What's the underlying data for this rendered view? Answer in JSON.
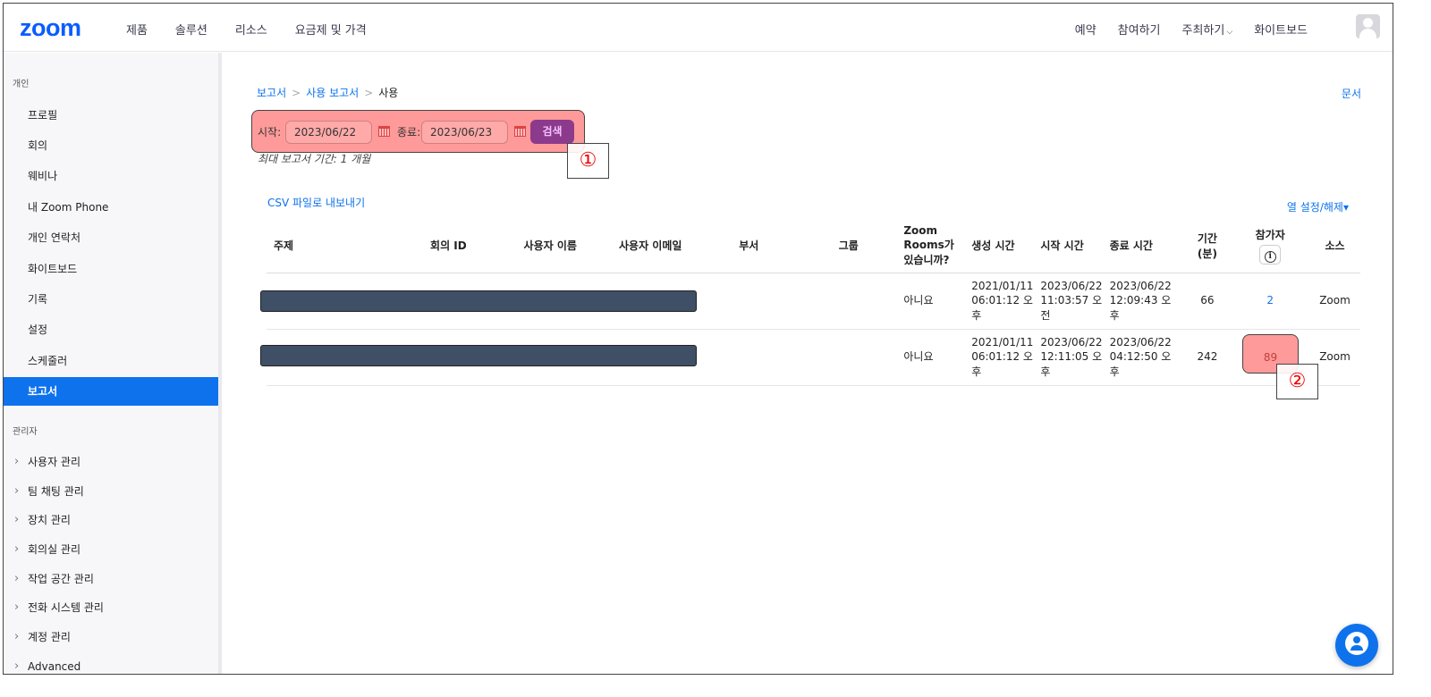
{
  "header": {
    "logo": "zoom",
    "nav_left": [
      "제품",
      "솔루션",
      "리소스",
      "요금제 및 가격"
    ],
    "nav_right": {
      "schedule": "예약",
      "join": "참여하기",
      "host": "주최하기",
      "whiteboard": "화이트보드"
    }
  },
  "sidebar": {
    "personal_label": "개인",
    "personal_items": [
      "프로필",
      "회의",
      "웨비나",
      "내 Zoom Phone",
      "개인 연락처",
      "화이트보드",
      "기록",
      "설정",
      "스케줄러",
      "보고서"
    ],
    "active_item": "보고서",
    "admin_label": "관리자",
    "admin_items": [
      "사용자 관리",
      "팀 채팅 관리",
      "장치 관리",
      "회의실 관리",
      "작업 공간 관리",
      "전화 시스템 관리",
      "계정 관리",
      "Advanced"
    ]
  },
  "breadcrumb": {
    "root": "보고서",
    "mid": "사용 보고서",
    "current": "사용"
  },
  "doc_link": "문서",
  "search": {
    "start_label": "시작:",
    "start_value": "2023/06/22",
    "end_label": "종료:",
    "end_value": "2023/06/23",
    "button": "검색",
    "note": "최대 보고서 기간: 1 개월"
  },
  "markers": {
    "one": "①",
    "two": "②"
  },
  "export_csv": "CSV 파일로 내보내기",
  "column_settings": "열 설정/해제▾",
  "table": {
    "headers": {
      "topic": "주제",
      "meeting_id": "회의 ID",
      "user_name": "사용자 이름",
      "user_email": "사용자 이메일",
      "department": "부서",
      "group": "그룹",
      "zoom_rooms": "Zoom Rooms가 있습니까?",
      "created": "생성 시간",
      "start": "시작 시간",
      "end": "종료 시간",
      "duration": "기간 (분)",
      "participants": "참가자",
      "source": "소스"
    },
    "rows": [
      {
        "zoom_rooms": "아니요",
        "created": "2021/01/11 06:01:12 오후",
        "start": "2023/06/22 11:03:57 오전",
        "end": "2023/06/22 12:09:43 오후",
        "duration": "66",
        "participants": "2",
        "source": "Zoom"
      },
      {
        "zoom_rooms": "아니요",
        "created": "2021/01/11 06:01:12 오후",
        "start": "2023/06/22 12:11:05 오후",
        "end": "2023/06/22 04:12:50 오후",
        "duration": "242",
        "participants": "89",
        "source": "Zoom"
      }
    ]
  }
}
